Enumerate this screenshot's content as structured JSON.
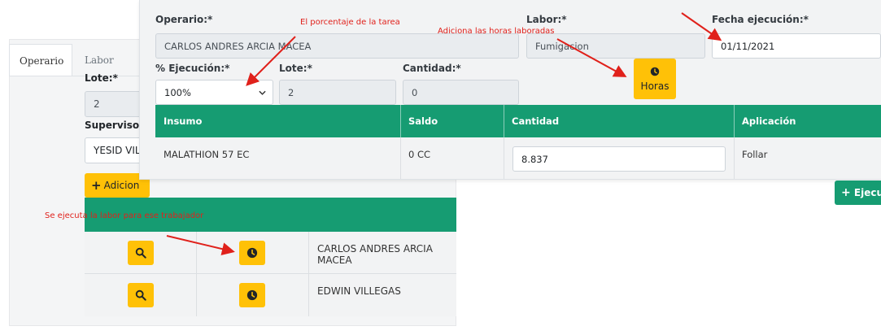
{
  "background": {
    "tabs": [
      "Operario",
      "Labor"
    ],
    "lote_label": "Lote:*",
    "lote_value": "2",
    "supervisor_label": "Supervisor:",
    "supervisor_value": "YESID VILL",
    "add_button_label": "Adicion",
    "workers": [
      {
        "name": "CARLOS ANDRES ARCIA MACEA"
      },
      {
        "name": "EDWIN VILLEGAS"
      }
    ]
  },
  "modal": {
    "operario_label": "Operario:*",
    "operario_value": "CARLOS ANDRES ARCIA MACEA",
    "labor_label": "Labor:*",
    "labor_value": "Fumigacion",
    "fecha_label": "Fecha ejecución:*",
    "fecha_value": "01/11/2021",
    "ejecucion_label": "% Ejecución:*",
    "ejecucion_value": "100%",
    "lote_label": "Lote:*",
    "lote_value": "2",
    "cantidad_label": "Cantidad:*",
    "cantidad_value": "0",
    "horas_label": "Horas",
    "table": {
      "headers": [
        "Insumo",
        "Saldo",
        "Cantidad",
        "Aplicación"
      ],
      "rows": [
        {
          "insumo": "MALATHION 57 EC",
          "saldo": "0 CC",
          "cantidad": "8.837",
          "aplicacion": "Follar"
        }
      ]
    },
    "ejecutar_label": "Ejecut"
  },
  "annotations": {
    "porcentaje": "El porcentaje de la tarea",
    "horas": "Adiciona las horas laboradas",
    "trabajador": "Se ejecuta la labor para ese trabajador"
  },
  "colors": {
    "green": "#169c72",
    "yellow": "#ffc107",
    "annotation_red": "#e0211b"
  },
  "icons": {
    "search": "search-icon",
    "clock": "clock-icon",
    "plus": "plus-icon",
    "dropdown": "chevron-down-icon"
  }
}
